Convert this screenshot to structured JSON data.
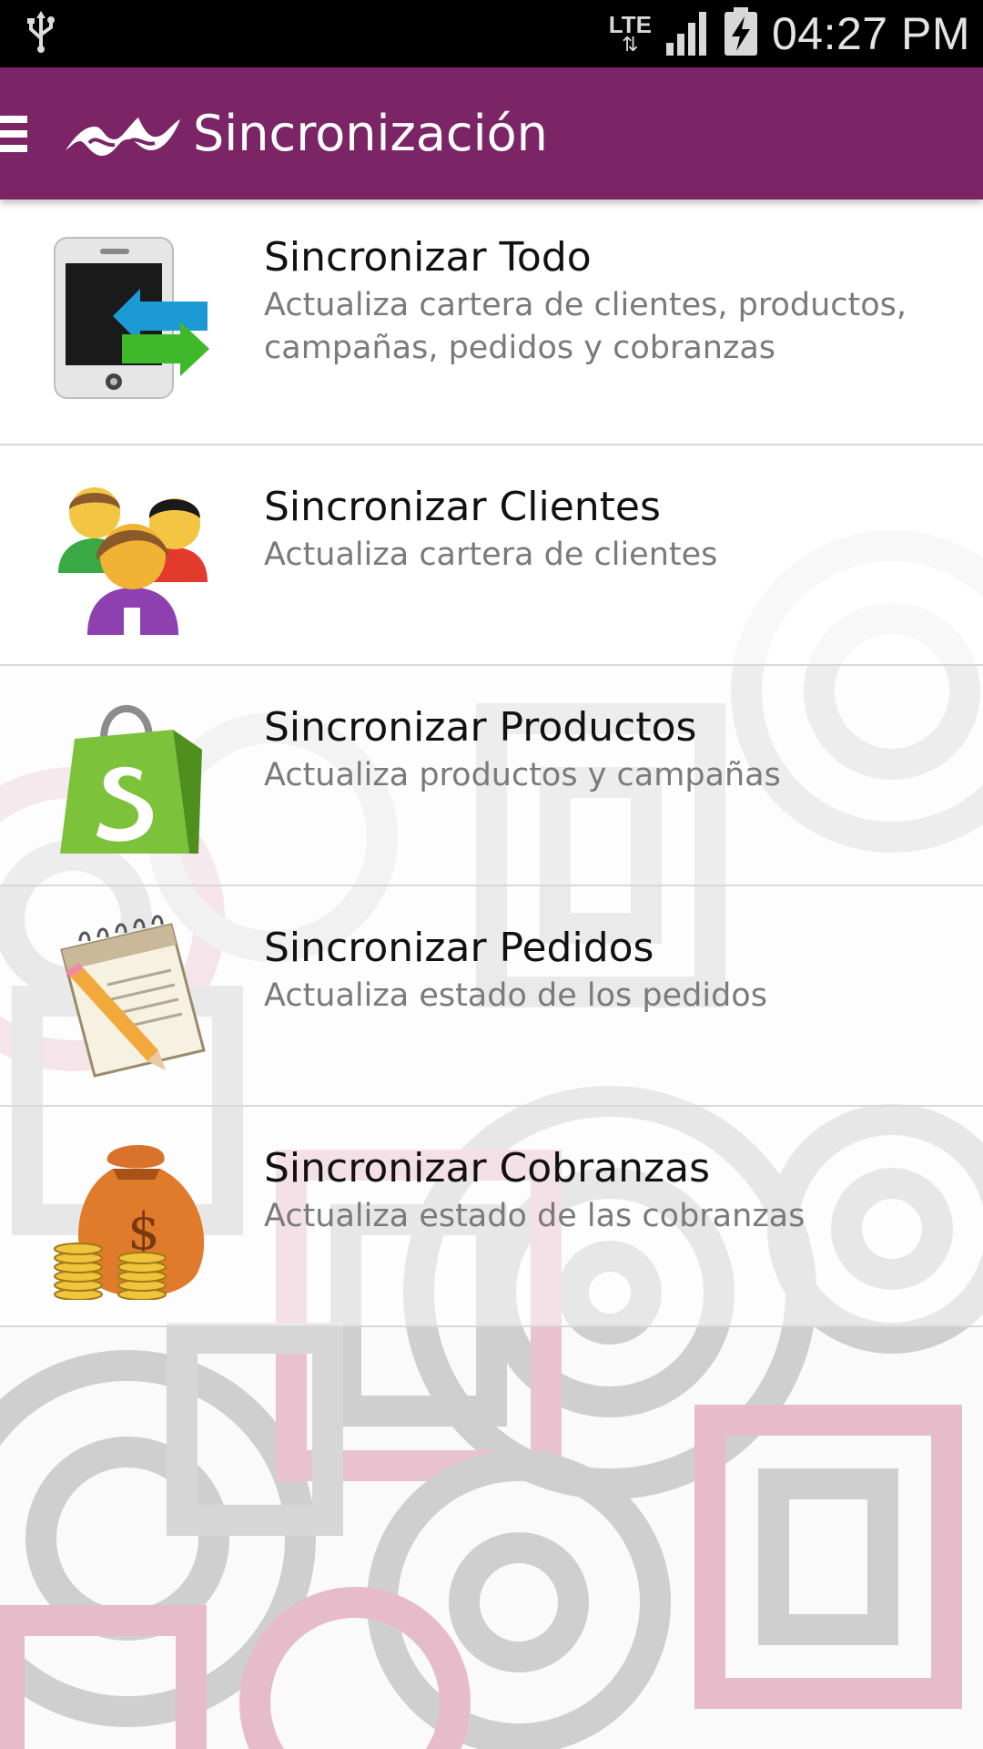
{
  "status_bar": {
    "network": "LTE",
    "network_arrows": "⇅",
    "time": "04:27 PM"
  },
  "app_bar": {
    "title": "Sincronización"
  },
  "colors": {
    "app_bar": "#7b2466",
    "status_bar": "#000000",
    "title_text": "#111111",
    "subtitle_text": "#7a7a7a"
  },
  "items": [
    {
      "icon": "phone-sync-icon",
      "title": "Sincronizar Todo",
      "subtitle": "Actualiza cartera de clientes, productos, campañas, pedidos y cobranzas"
    },
    {
      "icon": "clients-group-icon",
      "title": "Sincronizar Clientes",
      "subtitle": "Actualiza cartera de clientes"
    },
    {
      "icon": "shopping-bag-icon",
      "title": "Sincronizar Productos",
      "subtitle": "Actualiza productos y campañas"
    },
    {
      "icon": "notepad-pencil-icon",
      "title": "Sincronizar Pedidos",
      "subtitle": "Actualiza estado de los pedidos"
    },
    {
      "icon": "money-bag-icon",
      "title": "Sincronizar Cobranzas",
      "subtitle": "Actualiza estado de las cobranzas"
    }
  ]
}
